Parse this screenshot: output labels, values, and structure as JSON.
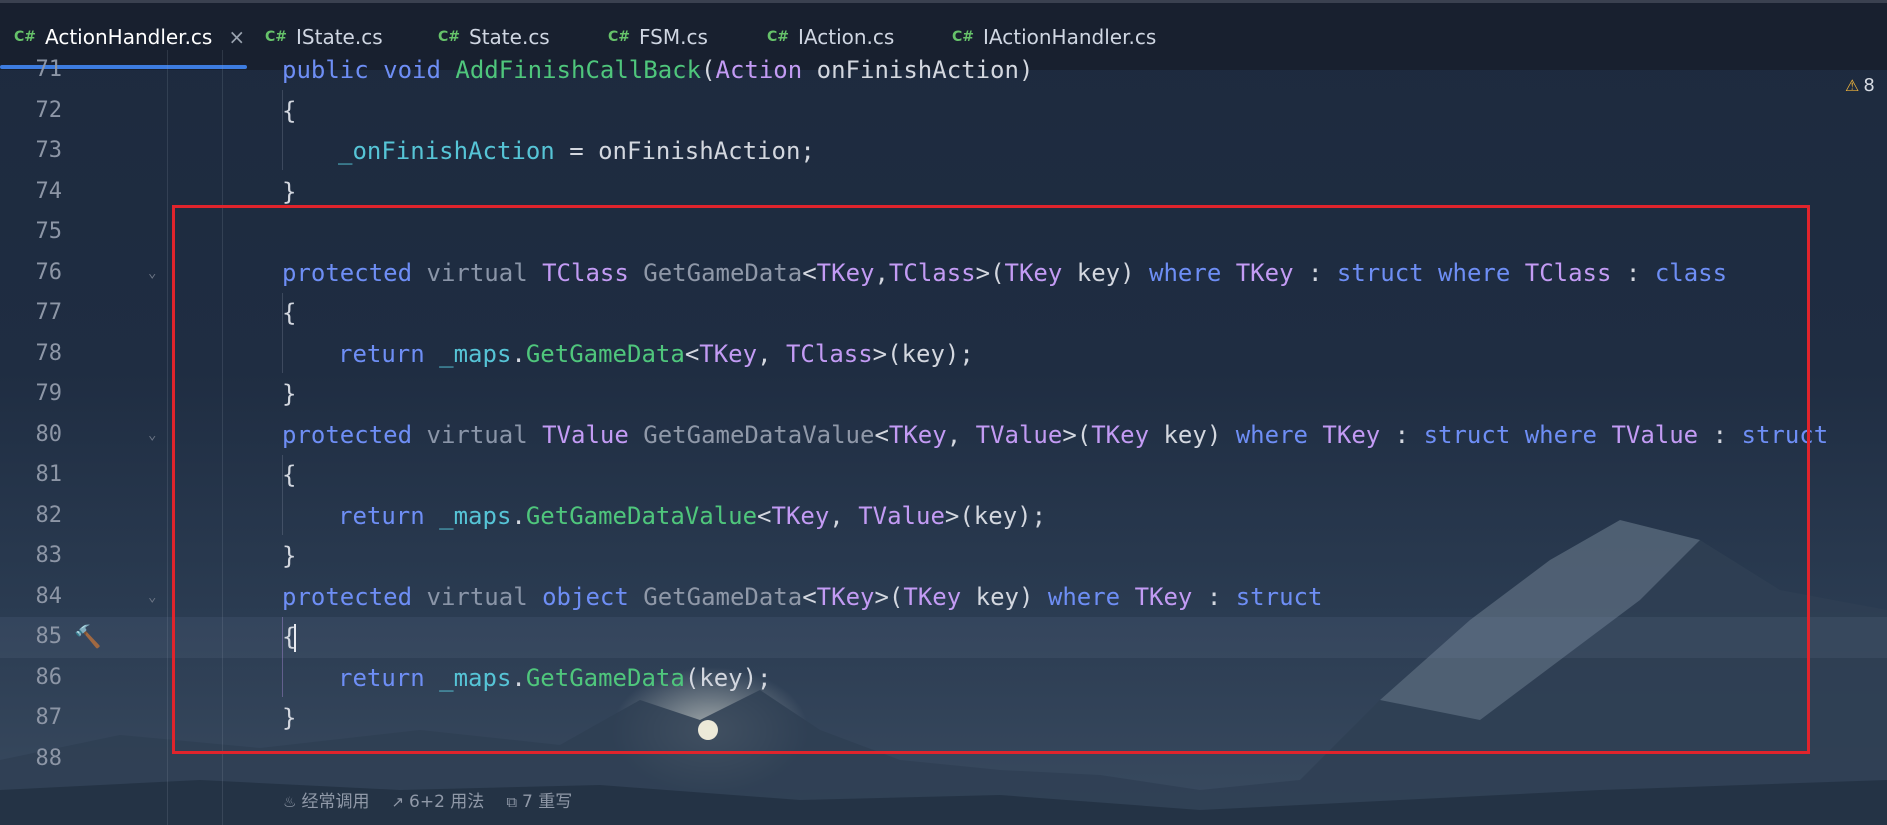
{
  "tabs": [
    {
      "icon": "C#",
      "label": "ActionHandler.cs",
      "active": true,
      "close": "×"
    },
    {
      "icon": "C#",
      "label": "IState.cs"
    },
    {
      "icon": "C#",
      "label": "State.cs"
    },
    {
      "icon": "C#",
      "label": "FSM.cs"
    },
    {
      "icon": "C#",
      "label": "IAction.cs"
    },
    {
      "icon": "C#",
      "label": "IActionHandler.cs"
    }
  ],
  "editor": {
    "current_line": 85,
    "warning_count": "8",
    "lines": [
      {
        "n": "71",
        "code": "public void AddFinishCallBack(Action onFinishAction)"
      },
      {
        "n": "72",
        "code": "{"
      },
      {
        "n": "73",
        "code": "_onFinishAction = onFinishAction;"
      },
      {
        "n": "74",
        "code": "}"
      },
      {
        "n": "75",
        "code": ""
      },
      {
        "n": "76",
        "code": "protected virtual TClass GetGameData<TKey,TClass>(TKey key) where TKey : struct where TClass : class"
      },
      {
        "n": "77",
        "code": "{"
      },
      {
        "n": "78",
        "code": "return _maps.GetGameData<TKey, TClass>(key);"
      },
      {
        "n": "79",
        "code": "}"
      },
      {
        "n": "80",
        "code": "protected virtual TValue GetGameDataValue<TKey, TValue>(TKey key) where TKey : struct where TValue : struct"
      },
      {
        "n": "81",
        "code": "{"
      },
      {
        "n": "82",
        "code": "return _maps.GetGameDataValue<TKey, TValue>(key);"
      },
      {
        "n": "83",
        "code": "}"
      },
      {
        "n": "84",
        "code": "protected virtual object GetGameData<TKey>(TKey key) where TKey : struct"
      },
      {
        "n": "85",
        "code": "{"
      },
      {
        "n": "86",
        "code": "return _maps.GetGameData(key);"
      },
      {
        "n": "87",
        "code": "}"
      },
      {
        "n": "88",
        "code": ""
      }
    ]
  },
  "hints": {
    "frequent": "经常调用",
    "usages": "6+2 用法",
    "overrides": "7 重写"
  },
  "colors": {
    "keyword": "#6e8ef5",
    "type": "#c39bf4",
    "method_call": "#4fc67c",
    "field": "#56c4d6",
    "highlight_box": "#e0242c",
    "tab_accent": "#3d7ce0"
  }
}
